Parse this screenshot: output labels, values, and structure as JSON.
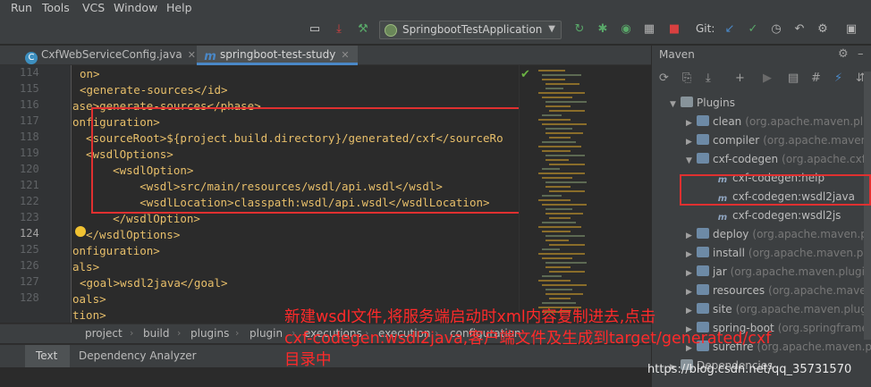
{
  "menu": [
    "Run",
    "Tools",
    "VCS",
    "Window",
    "Help"
  ],
  "toolbar": {
    "run_config": "SpringbootTestApplication",
    "git_label": "Git:"
  },
  "tabs": [
    {
      "label": "CxfWebServiceConfig.java",
      "icon": "C",
      "active": false
    },
    {
      "label": "springboot-test-study",
      "icon": "m",
      "active": true
    }
  ],
  "editor": {
    "line_numbers": [
      "114",
      "115",
      "116",
      "117",
      "118",
      "119",
      "120",
      "121",
      "122",
      "123",
      "124",
      "125",
      "126",
      "127",
      "128"
    ],
    "lines": [
      "on>",
      "<generate-sources</id>",
      "ase>generate-sources</phase>",
      "onfiguration>",
      "<sourceRoot>${project.build.directory}/generated/cxf</sourceRo",
      "<wsdlOptions>",
      "    <wsdlOption>",
      "        <wsdl>src/main/resources/wsdl/api.wsdl</wsdl>",
      "        <wsdlLocation>classpath:wsdl/api.wsdl</wsdlLocation>",
      "    </wsdlOption>",
      "</wsdlOptions>",
      "onfiguration>",
      "als>",
      "<goal>wsdl2java</goal>",
      "oals>",
      "tion>"
    ]
  },
  "breadcrumbs": [
    "project",
    "build",
    "plugins",
    "plugin",
    "executions",
    "execution",
    "configuration"
  ],
  "bottom_tabs": [
    "Text",
    "Dependency Analyzer"
  ],
  "maven": {
    "title": "Maven",
    "tree": [
      {
        "label": "Plugins",
        "group": "",
        "level": 0,
        "expanded": true,
        "kind": "folder"
      },
      {
        "label": "clean",
        "group": "(org.apache.maven.plug",
        "level": 1,
        "expanded": false,
        "kind": "plugin"
      },
      {
        "label": "compiler",
        "group": "(org.apache.maven.p",
        "level": 1,
        "expanded": false,
        "kind": "plugin"
      },
      {
        "label": "cxf-codegen",
        "group": "(org.apache.cxf",
        "level": 1,
        "expanded": true,
        "kind": "plugin"
      },
      {
        "label": "cxf-codegen:help",
        "group": "",
        "level": 2,
        "expanded": false,
        "kind": "goal"
      },
      {
        "label": "cxf-codegen:wsdl2java",
        "group": "",
        "level": 2,
        "expanded": false,
        "kind": "goal"
      },
      {
        "label": "cxf-codegen:wsdl2js",
        "group": "",
        "level": 2,
        "expanded": false,
        "kind": "goal"
      },
      {
        "label": "deploy",
        "group": "(org.apache.maven.pl",
        "level": 1,
        "expanded": false,
        "kind": "plugin"
      },
      {
        "label": "install",
        "group": "(org.apache.maven.pl",
        "level": 1,
        "expanded": false,
        "kind": "plugin"
      },
      {
        "label": "jar",
        "group": "(org.apache.maven.plugin",
        "level": 1,
        "expanded": false,
        "kind": "plugin"
      },
      {
        "label": "resources",
        "group": "(org.apache.maven.p",
        "level": 1,
        "expanded": false,
        "kind": "plugin"
      },
      {
        "label": "site",
        "group": "(org.apache.maven.plugi",
        "level": 1,
        "expanded": false,
        "kind": "plugin"
      },
      {
        "label": "spring-boot",
        "group": "(org.springframe",
        "level": 1,
        "expanded": false,
        "kind": "plugin"
      },
      {
        "label": "surefire",
        "group": "(org.apache.maven.p",
        "level": 1,
        "expanded": false,
        "kind": "plugin"
      },
      {
        "label": "Dependencies",
        "group": "",
        "level": 0,
        "expanded": false,
        "kind": "folder"
      }
    ]
  },
  "annotation": {
    "line1": "新建wsdl文件,将服务端启动时xml内容复制进去,点击",
    "line2": "cxf-codegen:wsdl2java,客户端文件及生成到target/generated/cxf",
    "line3": "目录中"
  },
  "watermark": "https://blog.csdn.net/qq_35731570",
  "colors": {
    "annotation_red": "#ff2a2a",
    "highlight_box": "#e03030",
    "tag": "#e8bf6a",
    "tab_accent": "#4a88c7"
  }
}
